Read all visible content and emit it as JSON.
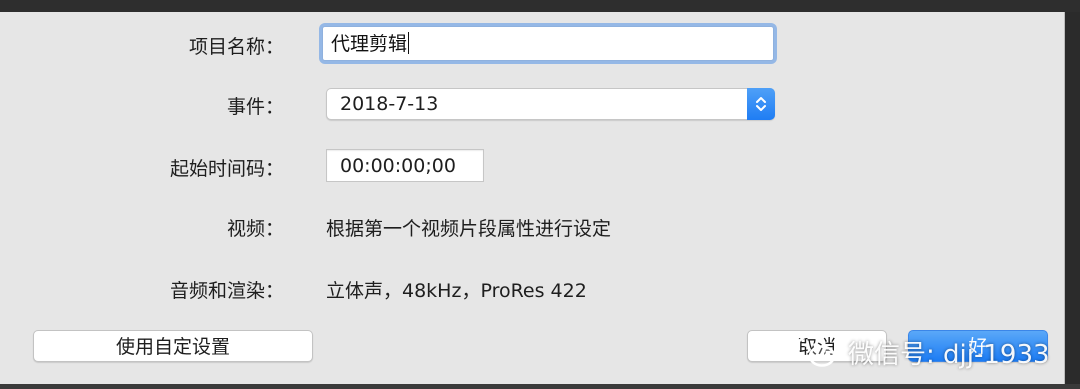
{
  "form": {
    "project_name_label": "项目名称：",
    "project_name_value": "代理剪辑",
    "event_label": "事件：",
    "event_value": "2018-7-13",
    "start_timecode_label": "起始时间码：",
    "start_timecode_value": "00:00:00;00",
    "video_label": "视频：",
    "video_value": "根据第一个视频片段属性进行设定",
    "audio_render_label": "音频和渲染：",
    "audio_render_value": "立体声，48kHz，ProRes 422"
  },
  "buttons": {
    "custom_settings": "使用自定设置",
    "cancel": "取消",
    "ok": "好"
  },
  "watermark": {
    "text": "微信号: djj-1933"
  },
  "colors": {
    "dialog_bg": "#e6e6e6",
    "accent_blue": "#1f7df4",
    "focus_ring": "#95b8e6"
  },
  "icons": {
    "stepper": "up-down-chevron-icon",
    "watermark": "wechat-logo-icon"
  }
}
